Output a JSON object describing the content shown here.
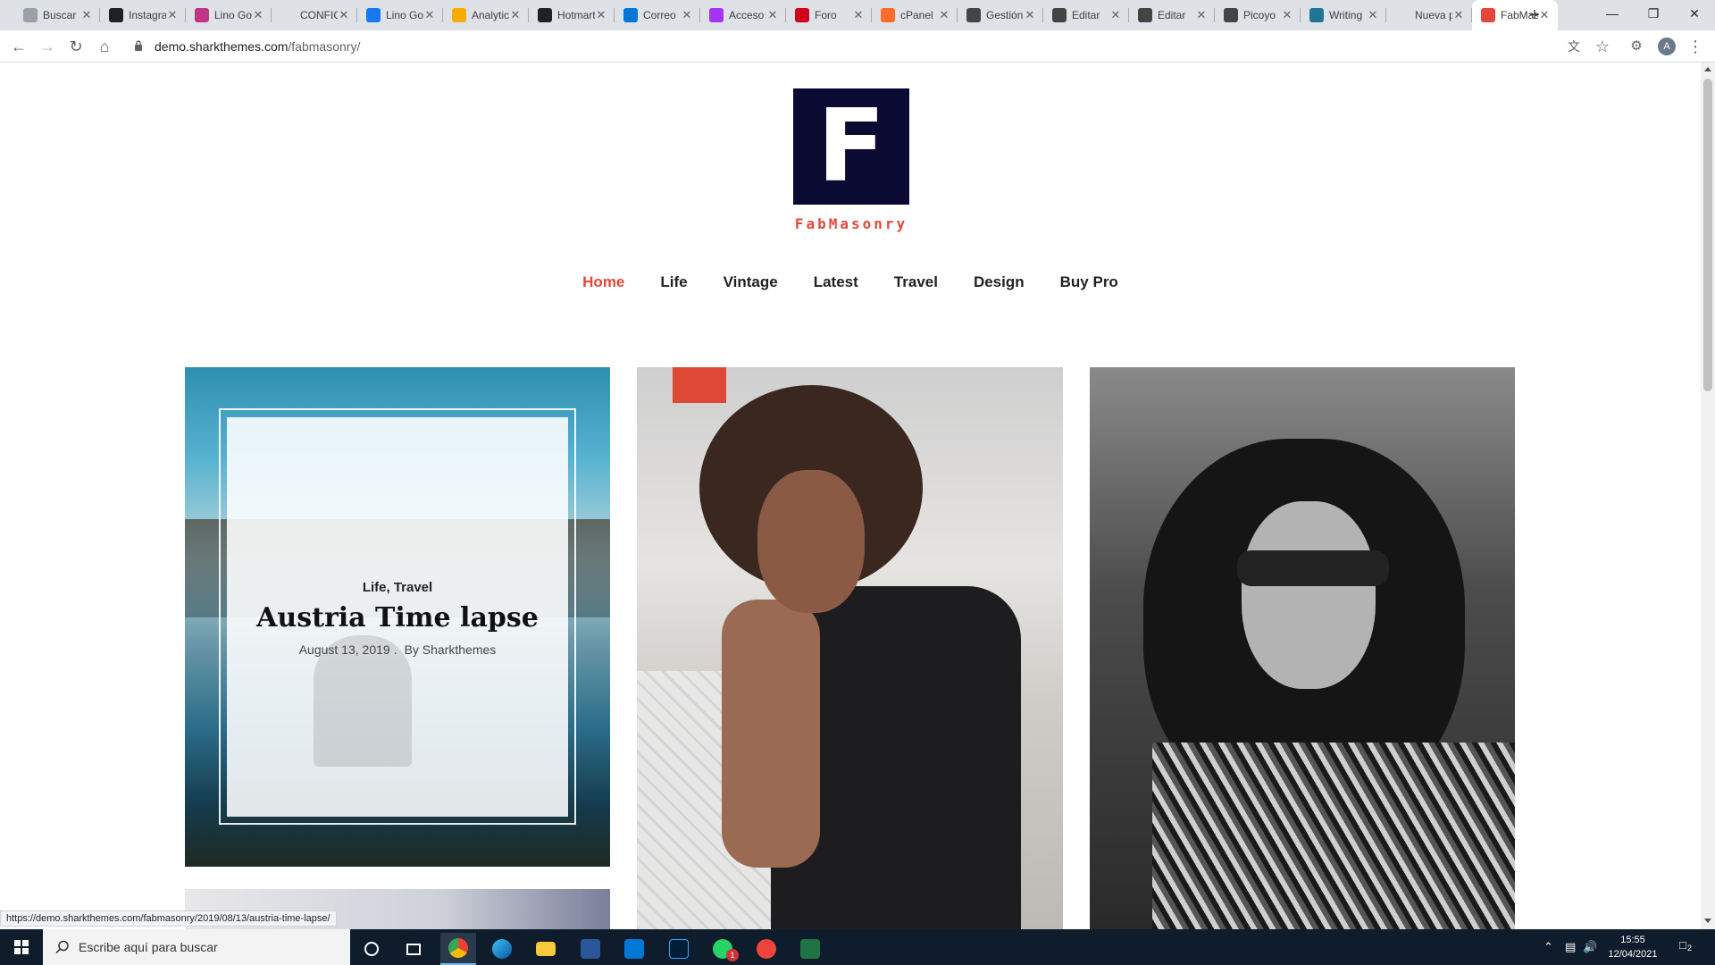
{
  "browser": {
    "tabs": [
      {
        "title": "Buscar",
        "favicon": "grid-icon",
        "color": "#9aa0a6"
      },
      {
        "title": "Instagram",
        "favicon": "infinity-icon",
        "color": "#202124"
      },
      {
        "title": "Lino Gonzalez",
        "favicon": "instagram-icon",
        "color": "#c13584"
      },
      {
        "title": "CONFIGURACION",
        "favicon": "blank-icon",
        "color": "#dee1e6"
      },
      {
        "title": "Lino Gonzalez",
        "favicon": "facebook-icon",
        "color": "#1877f2"
      },
      {
        "title": "Analytics",
        "favicon": "analytics-icon",
        "color": "#f9ab00"
      },
      {
        "title": "Hotmart",
        "favicon": "hotmart-icon",
        "color": "#202124"
      },
      {
        "title": "Correo",
        "favicon": "outlook-icon",
        "color": "#0078d4"
      },
      {
        "title": "Acceso",
        "favicon": "udemy-icon",
        "color": "#a435f0"
      },
      {
        "title": "Foro",
        "favicon": "foro-icon",
        "color": "#d0021b"
      },
      {
        "title": "cPanel",
        "favicon": "cpanel-icon",
        "color": "#ff6c2c"
      },
      {
        "title": "Gestión",
        "favicon": "gear-icon",
        "color": "#444"
      },
      {
        "title": "Editar",
        "favicon": "edit-icon",
        "color": "#444"
      },
      {
        "title": "Editar",
        "favicon": "edit-icon",
        "color": "#444"
      },
      {
        "title": "Picoyo",
        "favicon": "picoyo-icon",
        "color": "#444"
      },
      {
        "title": "Writing",
        "favicon": "wordpress-icon",
        "color": "#21759b"
      },
      {
        "title": "Nueva pestaña",
        "favicon": "blank-icon",
        "color": "#dee1e6"
      },
      {
        "title": "FabMasonry",
        "favicon": "fabmasonry-icon",
        "color": "#e4473a",
        "active": true
      }
    ],
    "new_tab": "+",
    "url_host": "demo.sharkthemes.com",
    "url_path": "/fabmasonry/",
    "avatar_initial": "A",
    "status_url": "https://demo.sharkthemes.com/fabmasonry/2019/08/13/austria-time-lapse/"
  },
  "site": {
    "logo_letter": "F",
    "title": "FabMasonry",
    "accent": "#e4473a",
    "logo_bg": "#0b0a33",
    "nav": [
      {
        "label": "Home",
        "active": true
      },
      {
        "label": "Life"
      },
      {
        "label": "Vintage"
      },
      {
        "label": "Latest"
      },
      {
        "label": "Travel"
      },
      {
        "label": "Design"
      },
      {
        "label": "Buy Pro"
      }
    ]
  },
  "posts": {
    "featured": {
      "categories": "Life, Travel",
      "title": "Austria Time lapse",
      "date": "August 13, 2019",
      "separator": ".",
      "author": "By Sharkthemes"
    }
  },
  "taskbar": {
    "search_placeholder": "Escribe aquí para buscar",
    "time": "15:55",
    "date": "12/04/2021",
    "notifications": "2",
    "whatsapp_badge": "1"
  }
}
